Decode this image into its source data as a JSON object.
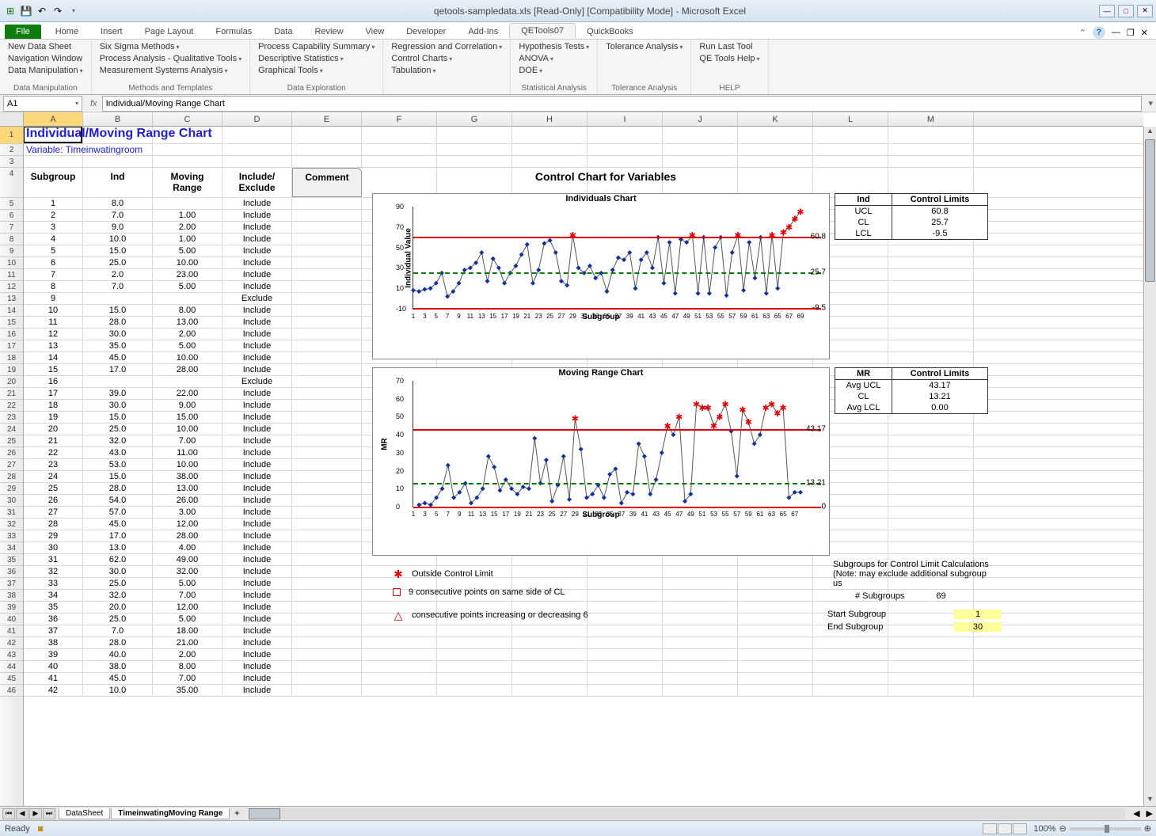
{
  "window": {
    "title": "qetools-sampledata.xls  [Read-Only]  [Compatibility Mode]  -  Microsoft Excel"
  },
  "ribbon": {
    "tabs": [
      "File",
      "Home",
      "Insert",
      "Page Layout",
      "Formulas",
      "Data",
      "Review",
      "View",
      "Developer",
      "Add-Ins",
      "QETools07",
      "QuickBooks"
    ],
    "active": "QETools07",
    "groups": [
      {
        "label": "Data Manipulation",
        "items": [
          "New Data Sheet",
          "Navigation Window",
          "Data Manipulation"
        ],
        "dd": [
          false,
          false,
          true
        ]
      },
      {
        "label": "Methods and Templates",
        "items": [
          "Six Sigma Methods",
          "Process Analysis - Qualitative Tools",
          "Measurement Systems Analysis"
        ],
        "dd": [
          true,
          true,
          true
        ]
      },
      {
        "label": "Data Exploration",
        "items": [
          "Process Capability Summary",
          "Descriptive Statistics",
          "Graphical Tools"
        ],
        "dd": [
          true,
          true,
          true
        ]
      },
      {
        "label": "",
        "items": [
          "Regression and Correlation",
          "Control Charts",
          "Tabulation"
        ],
        "dd": [
          true,
          true,
          true
        ]
      },
      {
        "label": "Statistical Analysis",
        "items": [
          "Hypothesis Tests",
          "ANOVA",
          "DOE"
        ],
        "dd": [
          true,
          true,
          true
        ]
      },
      {
        "label": "Tolerance Analysis",
        "items": [
          "Tolerance Analysis"
        ],
        "dd": [
          true
        ]
      },
      {
        "label": "HELP",
        "items": [
          "Run Last Tool",
          "QE Tools Help"
        ],
        "dd": [
          false,
          true
        ]
      }
    ]
  },
  "namebox": "A1",
  "formula": "Individual/Moving Range Chart",
  "columns": [
    "A",
    "B",
    "C",
    "D",
    "E",
    "F",
    "G",
    "H",
    "I",
    "J",
    "K",
    "L",
    "M"
  ],
  "sheet": {
    "title": "Individual/Moving Range Chart",
    "subtitle": "Variable:  Timeinwatingroom",
    "headers": {
      "a": "Subgroup",
      "b": "Ind",
      "c": "Moving Range",
      "d": "Include/ Exclude",
      "e": "Comment"
    },
    "rows": [
      {
        "sg": 1,
        "ind": "8.0",
        "mr": "",
        "inc": "Include"
      },
      {
        "sg": 2,
        "ind": "7.0",
        "mr": "1.00",
        "inc": "Include"
      },
      {
        "sg": 3,
        "ind": "9.0",
        "mr": "2.00",
        "inc": "Include"
      },
      {
        "sg": 4,
        "ind": "10.0",
        "mr": "1.00",
        "inc": "Include"
      },
      {
        "sg": 5,
        "ind": "15.0",
        "mr": "5.00",
        "inc": "Include"
      },
      {
        "sg": 6,
        "ind": "25.0",
        "mr": "10.00",
        "inc": "Include"
      },
      {
        "sg": 7,
        "ind": "2.0",
        "mr": "23.00",
        "inc": "Include"
      },
      {
        "sg": 8,
        "ind": "7.0",
        "mr": "5.00",
        "inc": "Include"
      },
      {
        "sg": 9,
        "ind": "",
        "mr": "",
        "inc": "Exclude"
      },
      {
        "sg": 10,
        "ind": "15.0",
        "mr": "8.00",
        "inc": "Include"
      },
      {
        "sg": 11,
        "ind": "28.0",
        "mr": "13.00",
        "inc": "Include"
      },
      {
        "sg": 12,
        "ind": "30.0",
        "mr": "2.00",
        "inc": "Include"
      },
      {
        "sg": 13,
        "ind": "35.0",
        "mr": "5.00",
        "inc": "Include"
      },
      {
        "sg": 14,
        "ind": "45.0",
        "mr": "10.00",
        "inc": "Include"
      },
      {
        "sg": 15,
        "ind": "17.0",
        "mr": "28.00",
        "inc": "Include"
      },
      {
        "sg": 16,
        "ind": "",
        "mr": "",
        "inc": "Exclude"
      },
      {
        "sg": 17,
        "ind": "39.0",
        "mr": "22.00",
        "inc": "Include"
      },
      {
        "sg": 18,
        "ind": "30.0",
        "mr": "9.00",
        "inc": "Include"
      },
      {
        "sg": 19,
        "ind": "15.0",
        "mr": "15.00",
        "inc": "Include"
      },
      {
        "sg": 20,
        "ind": "25.0",
        "mr": "10.00",
        "inc": "Include"
      },
      {
        "sg": 21,
        "ind": "32.0",
        "mr": "7.00",
        "inc": "Include"
      },
      {
        "sg": 22,
        "ind": "43.0",
        "mr": "11.00",
        "inc": "Include"
      },
      {
        "sg": 23,
        "ind": "53.0",
        "mr": "10.00",
        "inc": "Include"
      },
      {
        "sg": 24,
        "ind": "15.0",
        "mr": "38.00",
        "inc": "Include"
      },
      {
        "sg": 25,
        "ind": "28.0",
        "mr": "13.00",
        "inc": "Include"
      },
      {
        "sg": 26,
        "ind": "54.0",
        "mr": "26.00",
        "inc": "Include"
      },
      {
        "sg": 27,
        "ind": "57.0",
        "mr": "3.00",
        "inc": "Include"
      },
      {
        "sg": 28,
        "ind": "45.0",
        "mr": "12.00",
        "inc": "Include"
      },
      {
        "sg": 29,
        "ind": "17.0",
        "mr": "28.00",
        "inc": "Include"
      },
      {
        "sg": 30,
        "ind": "13.0",
        "mr": "4.00",
        "inc": "Include"
      },
      {
        "sg": 31,
        "ind": "62.0",
        "mr": "49.00",
        "inc": "Include"
      },
      {
        "sg": 32,
        "ind": "30.0",
        "mr": "32.00",
        "inc": "Include"
      },
      {
        "sg": 33,
        "ind": "25.0",
        "mr": "5.00",
        "inc": "Include"
      },
      {
        "sg": 34,
        "ind": "32.0",
        "mr": "7.00",
        "inc": "Include"
      },
      {
        "sg": 35,
        "ind": "20.0",
        "mr": "12.00",
        "inc": "Include"
      },
      {
        "sg": 36,
        "ind": "25.0",
        "mr": "5.00",
        "inc": "Include"
      },
      {
        "sg": 37,
        "ind": "7.0",
        "mr": "18.00",
        "inc": "Include"
      },
      {
        "sg": 38,
        "ind": "28.0",
        "mr": "21.00",
        "inc": "Include"
      },
      {
        "sg": 39,
        "ind": "40.0",
        "mr": "2.00",
        "inc": "Include"
      },
      {
        "sg": 40,
        "ind": "38.0",
        "mr": "8.00",
        "inc": "Include"
      },
      {
        "sg": 41,
        "ind": "45.0",
        "mr": "7.00",
        "inc": "Include"
      },
      {
        "sg": 42,
        "ind": "10.0",
        "mr": "35.00",
        "inc": "Include"
      }
    ]
  },
  "charts": {
    "main_title": "Control Chart for Variables",
    "ind": {
      "title": "Individuals Chart",
      "ylabel": "Individual Value",
      "xlabel": "Subgroup",
      "ucl": 60.8,
      "cl": 25.7,
      "lcl": -9.5,
      "ymin": -10,
      "ymax": 90,
      "yticks": [
        -10,
        10,
        30,
        50,
        70,
        90
      ]
    },
    "mr": {
      "title": "Moving Range Chart",
      "ylabel": "MR",
      "xlabel": "Subgroup",
      "ucl": 43.17,
      "cl": 13.21,
      "lcl": 0.0,
      "ymin": 0,
      "ymax": 70,
      "yticks": [
        0,
        10,
        20,
        30,
        40,
        50,
        60,
        70
      ]
    },
    "xticks": [
      1,
      3,
      5,
      7,
      9,
      11,
      13,
      15,
      17,
      19,
      21,
      23,
      25,
      27,
      29,
      31,
      33,
      35,
      37,
      39,
      41,
      43,
      45,
      47,
      49,
      51,
      53,
      55,
      57,
      59,
      61,
      63,
      65,
      67,
      69
    ]
  },
  "chart_data": {
    "type": "line",
    "series": [
      {
        "name": "Ind",
        "values": [
          8,
          7,
          9,
          10,
          15,
          25,
          2,
          7,
          15,
          28,
          30,
          35,
          45,
          17,
          39,
          30,
          15,
          25,
          32,
          43,
          53,
          15,
          28,
          54,
          57,
          45,
          17,
          13,
          62,
          30,
          25,
          32,
          20,
          25,
          7,
          28,
          40,
          38,
          45,
          10,
          38,
          45,
          30,
          60,
          15,
          55,
          5,
          58,
          55,
          62,
          5,
          60,
          5,
          50,
          60,
          3,
          45,
          62,
          8,
          55,
          20,
          60,
          5,
          62,
          10,
          65,
          70,
          78,
          85
        ]
      },
      {
        "name": "MR",
        "values": [
          null,
          1,
          2,
          1,
          5,
          10,
          23,
          5,
          8,
          13,
          2,
          5,
          10,
          28,
          22,
          9,
          15,
          10,
          7,
          11,
          10,
          38,
          13,
          26,
          3,
          12,
          28,
          4,
          49,
          32,
          5,
          7,
          12,
          5,
          18,
          21,
          2,
          8,
          7,
          35,
          28,
          7,
          15,
          30,
          45,
          40,
          50,
          3,
          7,
          57,
          55,
          55,
          45,
          50,
          57,
          42,
          17,
          54,
          47,
          35,
          40,
          55,
          57,
          52,
          55,
          5,
          8,
          8
        ]
      }
    ],
    "x": "1..69",
    "ind_limits": {
      "UCL": 60.8,
      "CL": 25.7,
      "LCL": -9.5
    },
    "mr_limits": {
      "Avg UCL": 43.17,
      "CL": 13.21,
      "Avg LCL": 0.0
    }
  },
  "cl_tables": {
    "ind": {
      "header1": "Ind",
      "header2": "Control Limits",
      "rows": [
        [
          "UCL",
          "60.8"
        ],
        [
          "CL",
          "25.7"
        ],
        [
          "LCL",
          "-9.5"
        ]
      ]
    },
    "mr": {
      "header1": "MR",
      "header2": "Control Limits",
      "rows": [
        [
          "Avg UCL",
          "43.17"
        ],
        [
          "CL",
          "13.21"
        ],
        [
          "Avg LCL",
          "0.00"
        ]
      ]
    }
  },
  "legend": {
    "l1": "Outside Control Limit",
    "l2": "9 consecutive points on same side of CL",
    "l3": "consecutive points increasing or decreasing 6"
  },
  "right_info": {
    "note": "Subgroups for Control Limit Calculations",
    "note2": "(Note: may exclude additional subgroup us",
    "n_subgroups_label": "# Subgroups",
    "n_subgroups": "69",
    "start_label": "Start Subgroup",
    "start": "1",
    "end_label": "End Subgroup",
    "end": "30"
  },
  "tabs": [
    "DataSheet",
    "TimeinwatingMoving Range"
  ],
  "status": {
    "ready": "Ready",
    "zoom": "100%"
  }
}
